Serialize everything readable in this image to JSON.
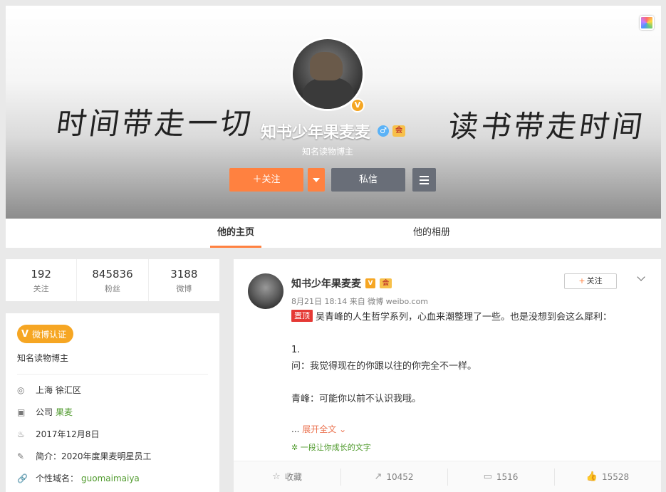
{
  "profile": {
    "banner_left_text": "时间带走一切",
    "banner_right_text": "读书带走时间",
    "nickname": "知书少年果麦麦",
    "verified_badge": "V",
    "gender_symbol": "♂",
    "vip_badge": "会",
    "headline": "知名读物博主",
    "follow_label": "＋关注",
    "message_label": "私信"
  },
  "tabs": [
    {
      "label": "他的主页",
      "active": true
    },
    {
      "label": "他的相册",
      "active": false
    }
  ],
  "counts": [
    {
      "value": "192",
      "label": "关注"
    },
    {
      "value": "845836",
      "label": "粉丝"
    },
    {
      "value": "3188",
      "label": "微博"
    }
  ],
  "info": {
    "cert_icon": "V",
    "cert_label": "微博认证",
    "cert_desc": "知名读物博主",
    "location": "上海 徐汇区",
    "company_prefix": "公司",
    "company": "果麦",
    "birthday": "2017年12月8日",
    "bio": "简介：2020年度果麦明星员工",
    "domain_label": "个性域名：",
    "domain": "guomaimaiya"
  },
  "post": {
    "author": "知书少年果麦麦",
    "v_badge": "V",
    "vip_badge": "会",
    "meta": "8月21日 18:14 来自 微博 weibo.com",
    "follow_label": "关注",
    "top_tag": "置顶",
    "line1": "吴青峰的人生哲学系列，心血来潮整理了一些。也是没想到会这么犀利：",
    "line2": "",
    "line3": "1.",
    "line4": "问：我觉得现在的你跟以往的你完全不一样。",
    "line5": "",
    "line6": "青峰：可能你以前不认识我哦。",
    "expand_prefix": "... ",
    "expand_label": "展开全文",
    "topic": "一段让你成长的文字",
    "actions": [
      {
        "icon": "☆",
        "label": "收藏"
      },
      {
        "icon": "↗",
        "label": "10452"
      },
      {
        "icon": "▭",
        "label": "1516"
      },
      {
        "icon": "👍",
        "label": "15528"
      }
    ]
  },
  "colors": {
    "accent": "#ff8140",
    "verified": "#f6a623",
    "link_green": "#4f9a2c",
    "secondary_button": "#696e78"
  }
}
